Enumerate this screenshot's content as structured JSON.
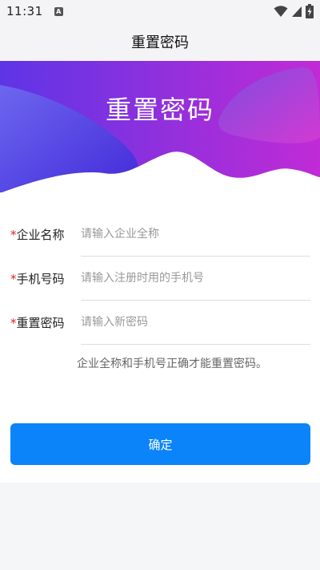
{
  "status_bar": {
    "time": "11:31",
    "notification_icon": "a-letter-icon"
  },
  "header": {
    "title": "重置密码"
  },
  "banner": {
    "title": "重置密码"
  },
  "form": {
    "fields": [
      {
        "required_mark": "*",
        "label": "企业名称",
        "placeholder": "请输入企业全称",
        "value": ""
      },
      {
        "required_mark": "*",
        "label": "手机号码",
        "placeholder": "请输入注册时用的手机号",
        "value": ""
      },
      {
        "required_mark": "*",
        "label": "重置密码",
        "placeholder": "请输入新密码",
        "value": ""
      }
    ],
    "hint": "企业全称和手机号正确才能重置密码。",
    "confirm_label": "确定"
  },
  "colors": {
    "accent": "#0a84f8",
    "banner_gradient_start": "#6a2ee8",
    "banner_gradient_end": "#c02bd6",
    "required": "#e02020"
  }
}
